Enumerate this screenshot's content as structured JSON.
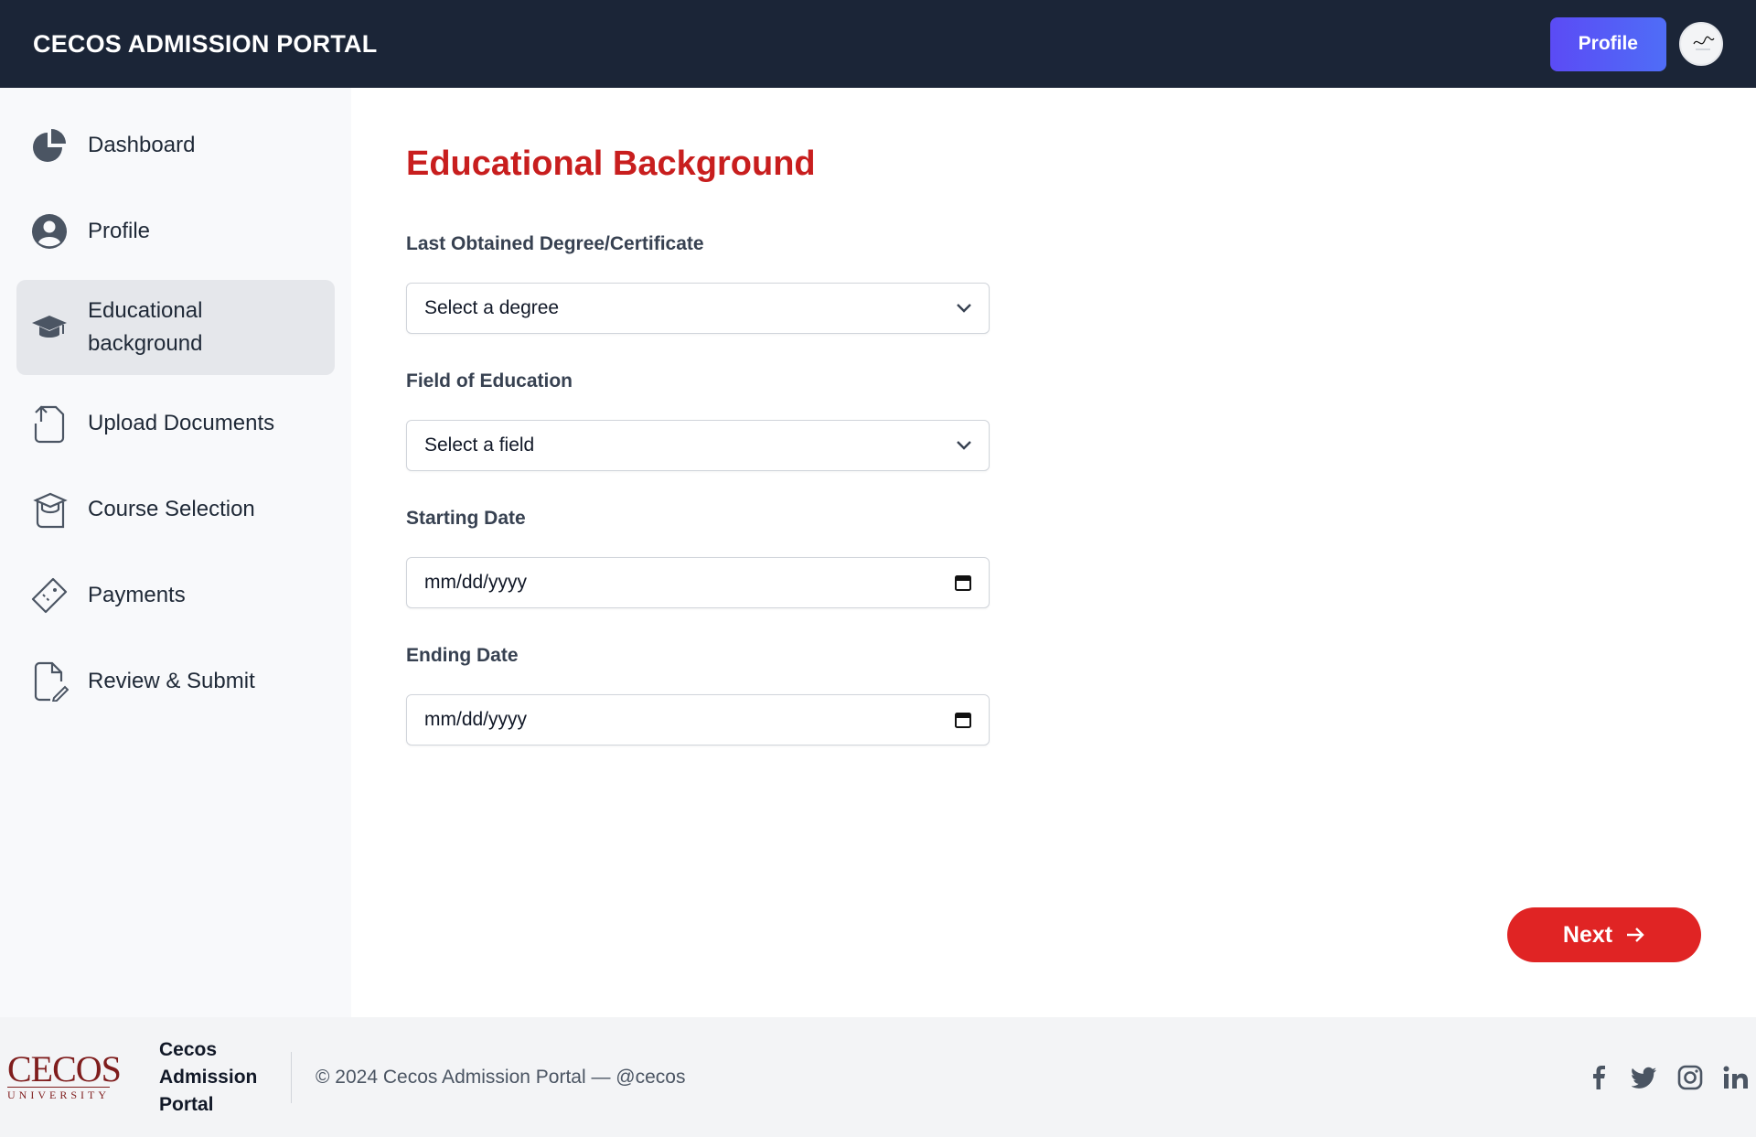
{
  "header": {
    "brand": "CECOS ADMISSION PORTAL",
    "profile_button": "Profile",
    "avatar_icon": "signature-avatar"
  },
  "sidebar": {
    "items": [
      {
        "label": "Dashboard",
        "icon": "pie-chart-icon",
        "active": false
      },
      {
        "label": "Profile",
        "icon": "user-circle-icon",
        "active": false
      },
      {
        "label": "Educational\nbackground",
        "icon": "graduation-cap-icon",
        "active": true
      },
      {
        "label": "Upload Documents",
        "icon": "upload-document-icon",
        "active": false
      },
      {
        "label": "Course Selection",
        "icon": "course-cap-icon",
        "active": false
      },
      {
        "label": "Payments",
        "icon": "ticket-icon",
        "active": false
      },
      {
        "label": "Review & Submit",
        "icon": "document-edit-icon",
        "active": false
      }
    ]
  },
  "main": {
    "title": "Educational Background",
    "fields": {
      "degree": {
        "label": "Last Obtained Degree/Certificate",
        "value": "Select a degree"
      },
      "field": {
        "label": "Field of Education",
        "value": "Select a field"
      },
      "start_date": {
        "label": "Starting Date",
        "value": "mm/dd/yyyy"
      },
      "end_date": {
        "label": "Ending Date",
        "value": "mm/dd/yyyy"
      }
    },
    "next_button": "Next"
  },
  "footer": {
    "logo_main": "CECOS",
    "logo_sub": "UNIVERSITY",
    "name": "Cecos Admission Portal",
    "copyright": "© 2024 Cecos Admission Portal — @cecos",
    "social": [
      "facebook-icon",
      "twitter-icon",
      "instagram-icon",
      "linkedin-icon"
    ]
  },
  "colors": {
    "header_bg": "#1b2537",
    "accent_red": "#e02424",
    "title_red": "#c81e1e",
    "profile_button": "#5b4bf5"
  }
}
